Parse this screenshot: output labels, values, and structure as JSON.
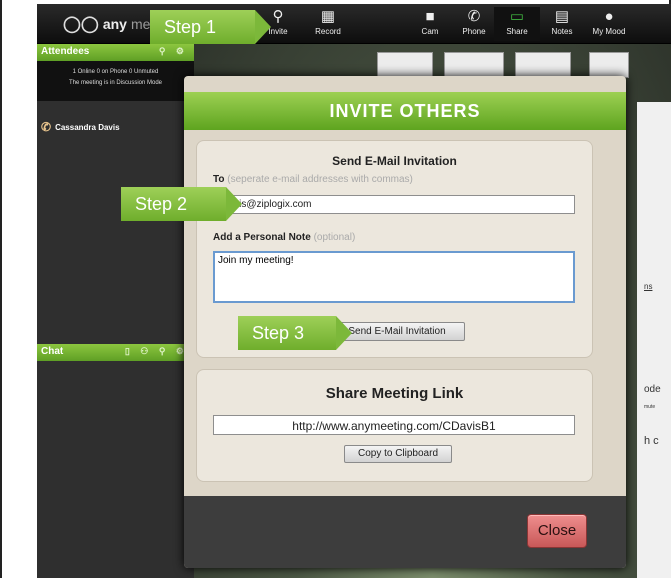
{
  "app": {
    "logo_main": "any",
    "logo_light": "meeti",
    "toolbar": [
      {
        "label": "Invite",
        "icon": "invite-person-icon"
      },
      {
        "label": "Record",
        "icon": "film-icon"
      },
      {
        "label": "Cam",
        "icon": "camera-icon"
      },
      {
        "label": "Phone",
        "icon": "phone-icon"
      },
      {
        "label": "Share",
        "icon": "monitor-icon"
      },
      {
        "label": "Notes",
        "icon": "notes-icon"
      },
      {
        "label": "My Mood",
        "icon": "person-icon"
      }
    ]
  },
  "attendees": {
    "title": "Attendees",
    "stats_line1": "1 Online    0 on Phone    0 Unmuted",
    "stats_line2": "The meeting is in Discussion Mode",
    "people": [
      {
        "name": "Cassandra Davis",
        "icon": "phone-icon"
      }
    ]
  },
  "chat": {
    "title": "Chat"
  },
  "stage_fragments": {
    "a": "ns",
    "b": "ode",
    "c": "mute",
    "d": "h c"
  },
  "modal": {
    "title": "INVITE OTHERS",
    "email_section_title": "Send E-Mail Invitation",
    "to_label": "To",
    "to_hint": "(seperate e-mail addresses with commas)",
    "to_value": "cdavis@ziplogix.com",
    "note_label": "Add a Personal Note",
    "note_hint": "(optional)",
    "note_value": "Join my meeting!",
    "send_button": "Send E-Mail Invitation",
    "link_section_title": "Share Meeting Link",
    "link_value": "http://www.anymeeting.com/CDavisB1",
    "copy_button": "Copy to Clipboard",
    "close_button": "Close"
  },
  "callouts": {
    "step1": "Step 1",
    "step2": "Step 2",
    "step3": "Step 3"
  }
}
